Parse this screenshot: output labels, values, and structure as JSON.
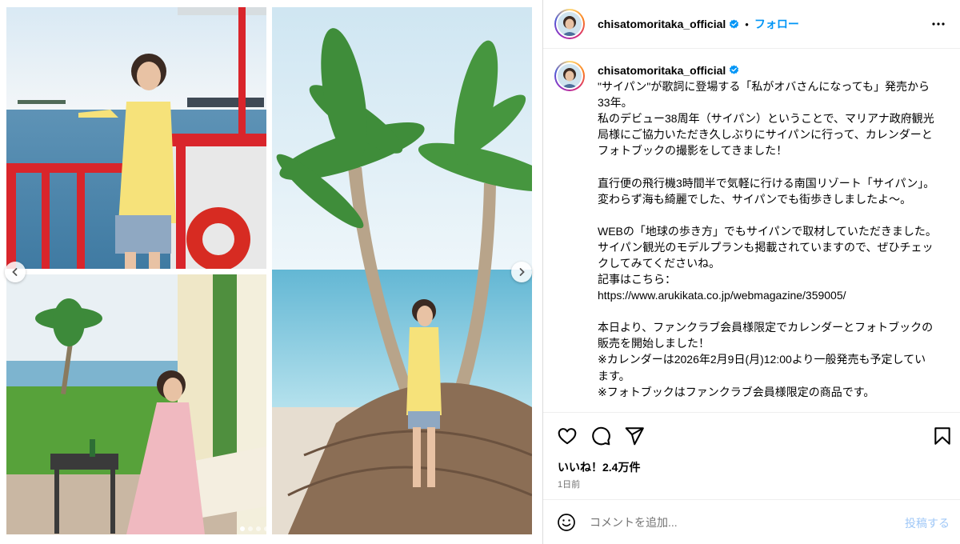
{
  "post": {
    "username": "chisatomoritaka_official",
    "separator": "•",
    "follow_label": "フォロー",
    "caption_lines": [
      "\"サイパン\"が歌詞に登場する「私がオバさんになっても」発売から33年。",
      "私のデビュー38周年（サイパン）ということで、マリアナ政府観光局様にご協力いただき久しぶりにサイパンに行って、カレンダーとフォトブックの撮影をしてきました！",
      "",
      "直行便の飛行機3時間半で気軽に行ける南国リゾート「サイパン」。",
      "変わらず海も綺麗でした、サイパンでも街歩きしましたよ〜。",
      "",
      "WEBの「地球の歩き方」でもサイパンで取材していただきました。",
      "サイパン観光のモデルプランも掲載されていますので、ぜひチェックしてみてくださいね。",
      "記事はこちら：",
      "https://www.arukikata.co.jp/webmagazine/359005/",
      "",
      "本日より、ファンクラブ会員様限定でカレンダーとフォトブックの販売を開始しました！",
      "※カレンダーは2026年2月9日(月)12:00より一般発売も予定しています。",
      "※フォトブックはファンクラブ会員様限定の商品です。"
    ],
    "likes_text": "いいね！2.4万件",
    "time_text": "1日前"
  },
  "comment": {
    "placeholder": "コメントを追加...",
    "post_label": "投稿する"
  },
  "carousel": {
    "dot_count": 4,
    "active_index": 0
  },
  "colors": {
    "link_blue": "#0095f6",
    "verified_blue": "#0095f6",
    "post_disabled": "#a0c8f7",
    "muted_text": "#737373"
  },
  "icons": {
    "like": "heart-icon",
    "comment": "comment-icon",
    "share": "share-icon",
    "save": "bookmark-icon",
    "emoji": "emoji-icon",
    "more": "more-icon",
    "verified": "verified-badge-icon",
    "prev": "chevron-left-icon",
    "next": "chevron-right-icon"
  }
}
